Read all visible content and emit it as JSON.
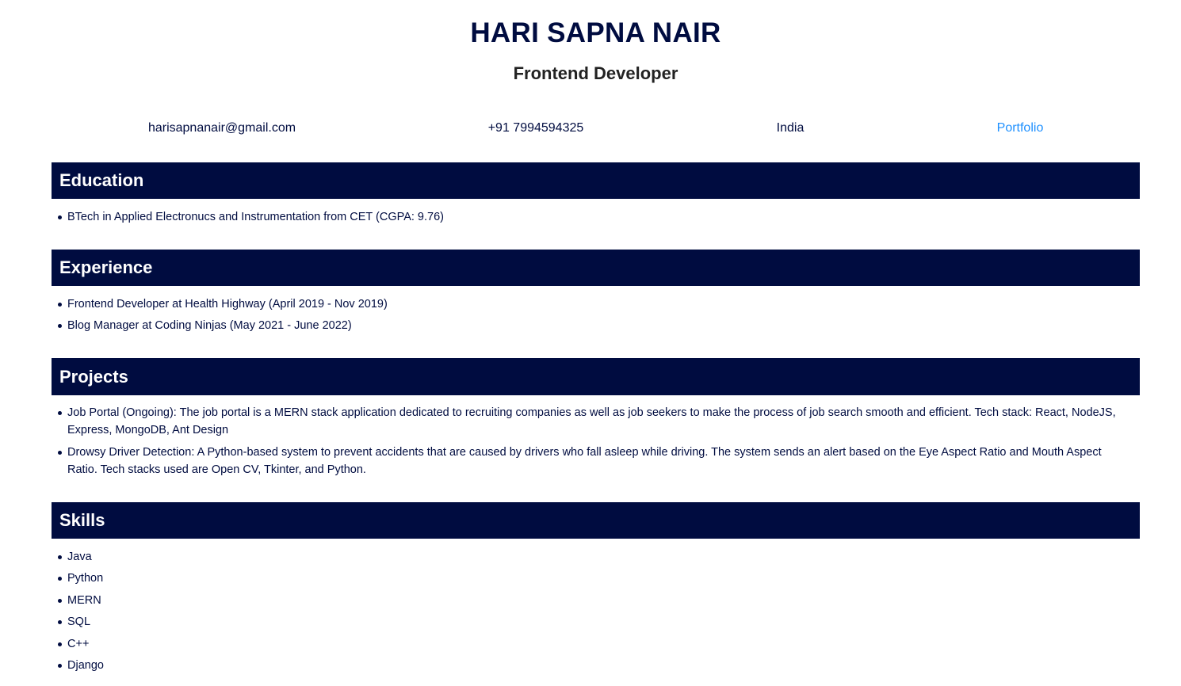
{
  "header": {
    "name": "HARI SAPNA NAIR",
    "title": "Frontend Developer"
  },
  "contact": {
    "email": "harisapnanair@gmail.com",
    "phone": "+91 7994594325",
    "country": "India",
    "portfolio_label": "Portfolio"
  },
  "education": {
    "heading": "Education",
    "items": [
      "BTech in Applied Electronucs and Instrumentation from CET (CGPA: 9.76)"
    ]
  },
  "experience": {
    "heading": "Experience",
    "items": [
      "Frontend Developer at Health Highway (April 2019 - Nov 2019)",
      "Blog Manager at Coding Ninjas (May 2021 - June 2022)"
    ]
  },
  "projects": {
    "heading": "Projects",
    "items": [
      "Job Portal (Ongoing): The job portal is a MERN stack application dedicated to recruiting companies as well as job seekers to make the process of job search smooth and efficient. Tech stack: React, NodeJS, Express, MongoDB, Ant Design",
      "Drowsy Driver Detection: A Python-based system to prevent accidents that are caused by drivers who fall asleep while driving. The system sends an alert based on the Eye Aspect Ratio and Mouth Aspect Ratio. Tech stacks used are Open CV, Tkinter, and Python."
    ]
  },
  "skills": {
    "heading": "Skills",
    "items": [
      "Java",
      "Python",
      "MERN",
      "SQL",
      "C++",
      "Django"
    ]
  },
  "colors": {
    "primary": "#000c40",
    "link": "#1e90ff",
    "subtitle": "#222222"
  }
}
